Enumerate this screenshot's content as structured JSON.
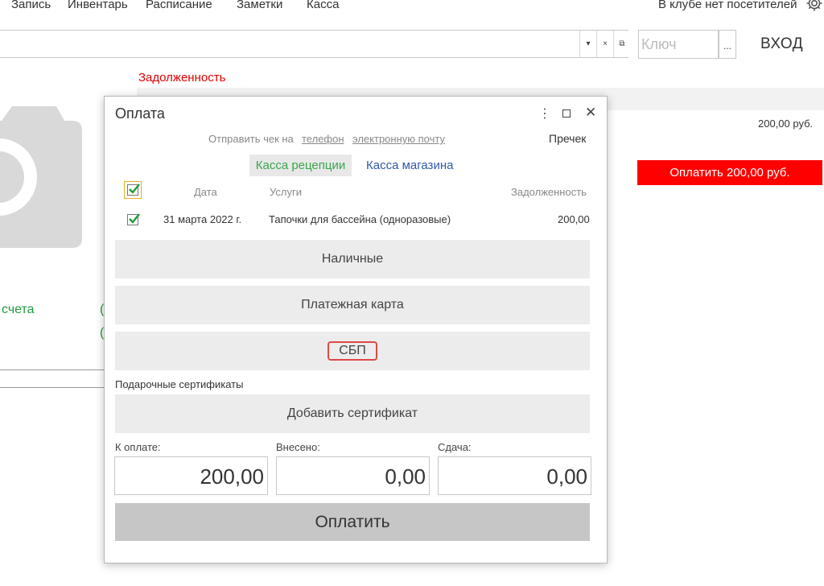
{
  "top_menu": {
    "items": [
      "Запись",
      "Инвентарь",
      "Расписание",
      "Заметки",
      "Касса"
    ],
    "visitors": "В клубе нет посетителей"
  },
  "search": {
    "key_placeholder": "Ключ",
    "key_dots": "...",
    "login": "ВХОД",
    "dropdown_glyph": "▾",
    "clear_glyph": "×",
    "open_glyph": "⧉"
  },
  "background": {
    "debt_label": "Задолженность",
    "amount": "200,00 руб.",
    "pay_button": "Оплатить 200,00 руб.",
    "accounts_label": "счета",
    "paren1": "(",
    "paren2": "("
  },
  "dialog": {
    "title": "Оплата",
    "more_glyph": "⋮",
    "close_glyph": "✕",
    "receipt": {
      "label": "Отправить чек на",
      "phone": "телефон",
      "email": "электронную почту"
    },
    "precheck": "Пречек",
    "tabs": {
      "reception": "Касса рецепции",
      "shop": "Касса магазина"
    },
    "table": {
      "headers": {
        "date": "Дата",
        "services": "Услуги",
        "debt": "Задолженность"
      },
      "rows": [
        {
          "date": "31 марта 2022 г.",
          "service": "Тапочки для бассейна (одноразовые)",
          "debt": "200,00",
          "checked": true
        }
      ]
    },
    "methods": {
      "cash": "Наличные",
      "card": "Платежная карта",
      "sbp": "СБП"
    },
    "gift": {
      "label": "Подарочные сертификаты",
      "add": "Добавить сертификат"
    },
    "sums": {
      "to_pay_label": "К оплате:",
      "to_pay": "200,00",
      "paid_label": "Внесено:",
      "paid": "0,00",
      "change_label": "Сдача:",
      "change": "0,00"
    },
    "pay_button": "Оплатить"
  },
  "colors": {
    "accent_red": "#ff0000",
    "green": "#3aa64b",
    "link_blue": "#2f5aa8",
    "highlight": "#e04848"
  }
}
